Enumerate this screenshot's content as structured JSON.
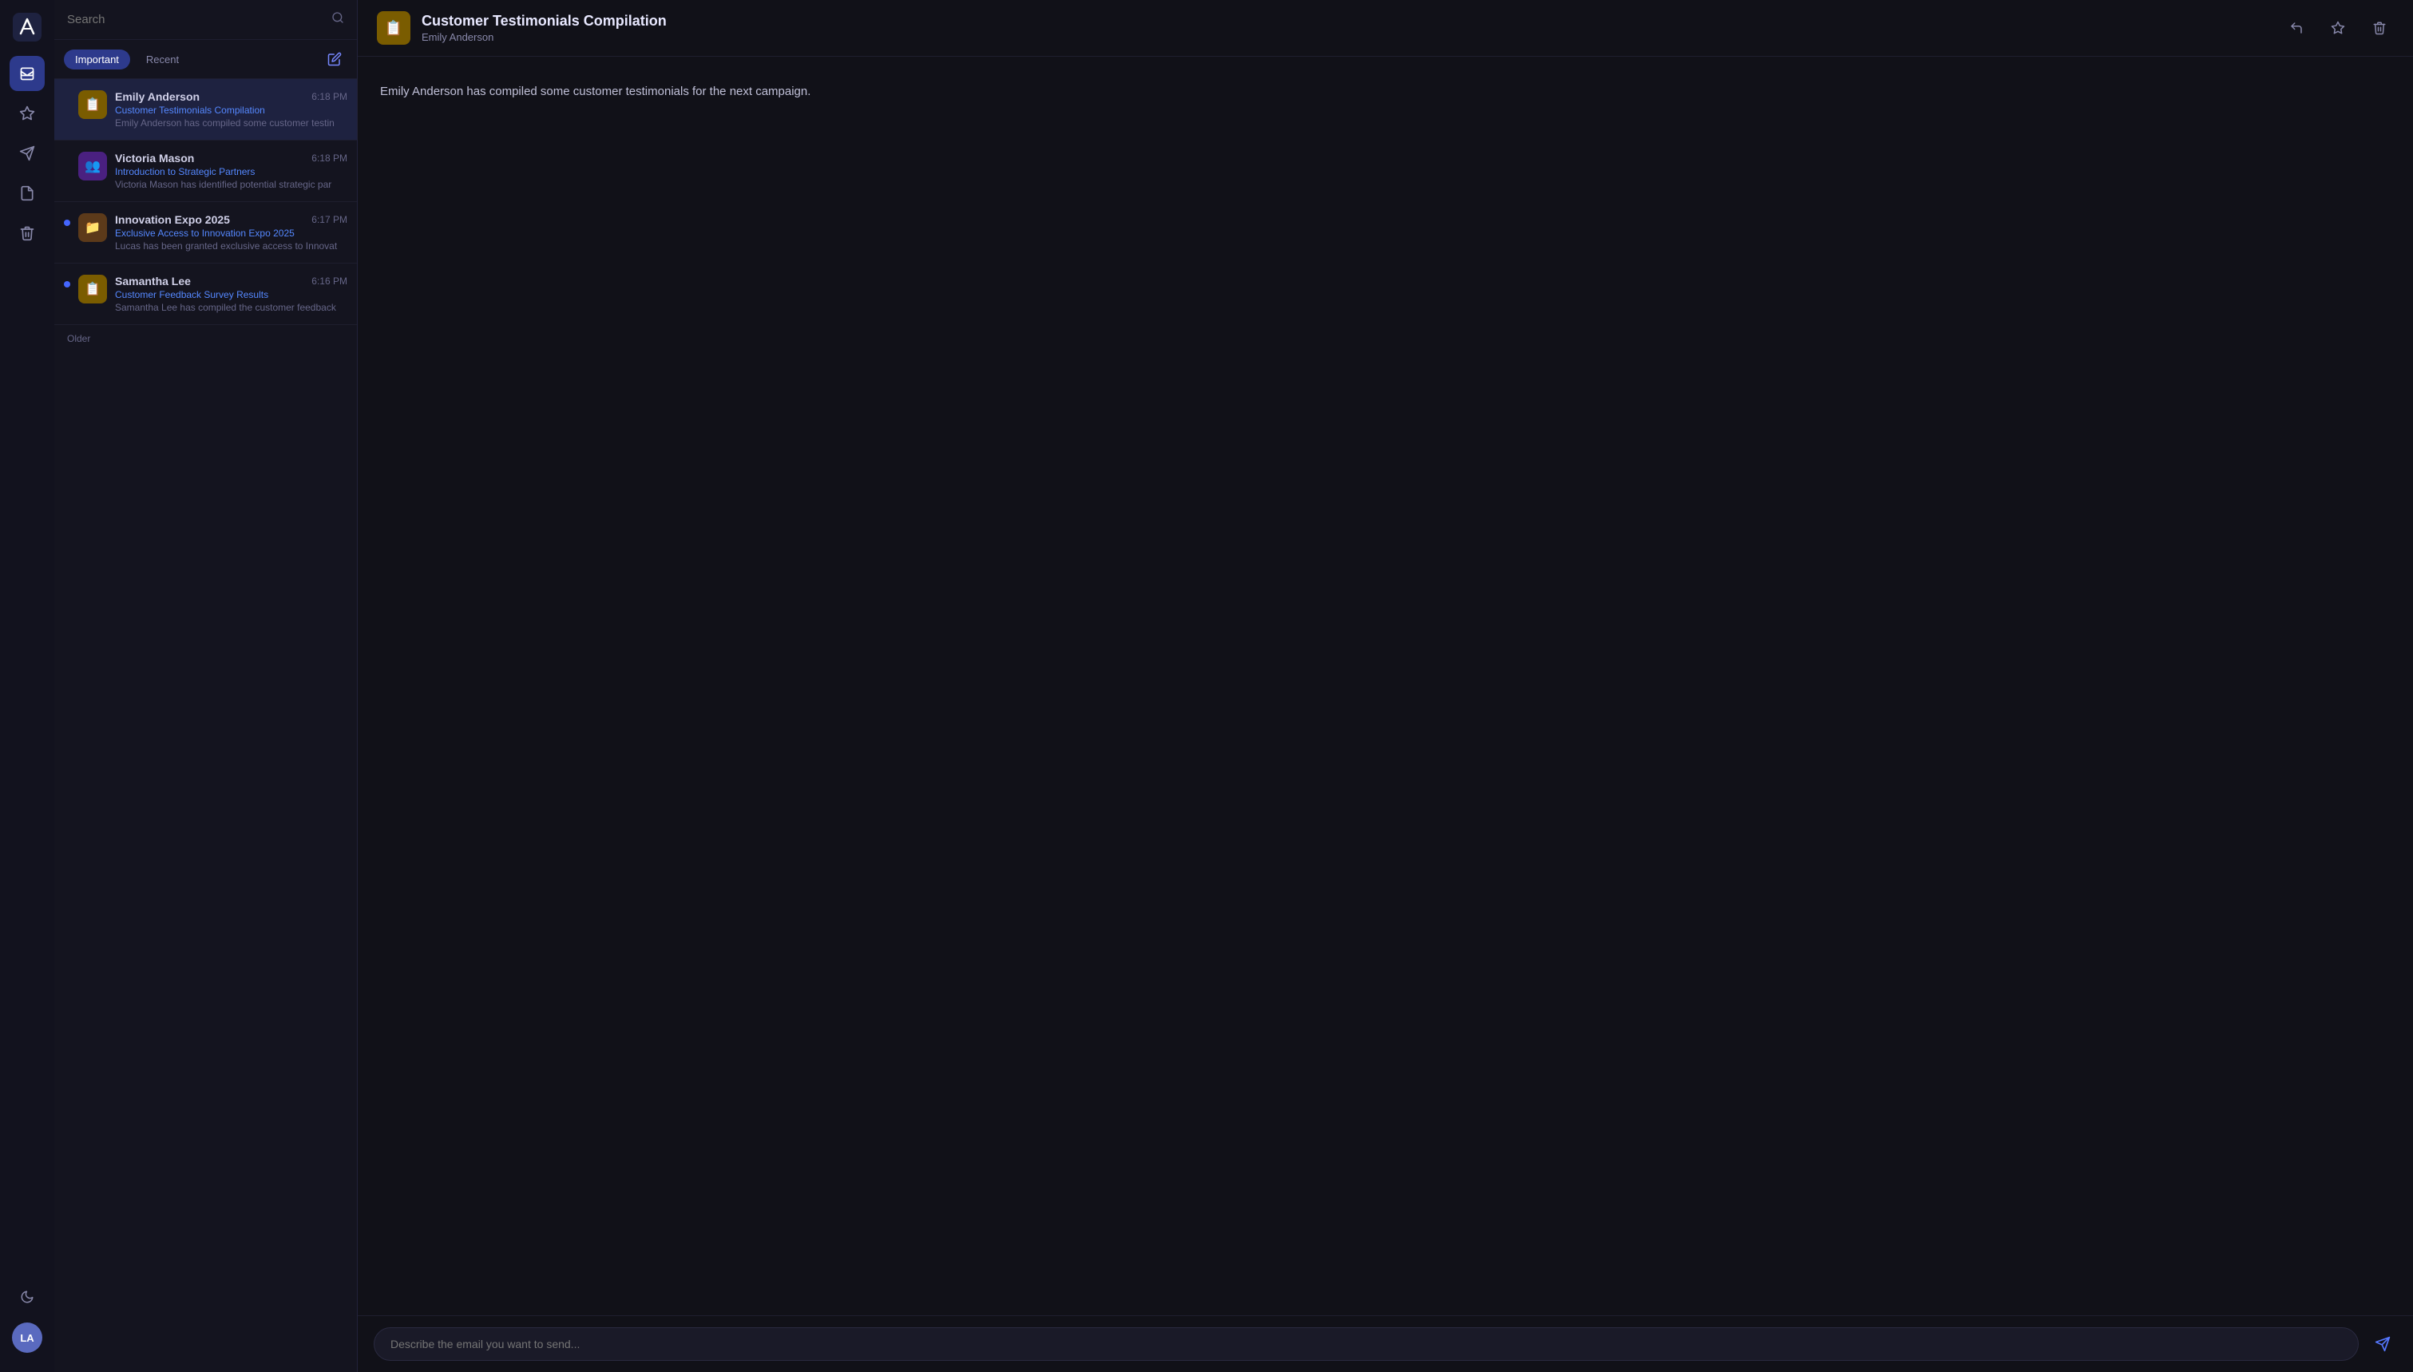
{
  "app": {
    "logo_text": "A",
    "avatar_initials": "LA"
  },
  "sidebar": {
    "icons": [
      {
        "name": "inbox-icon",
        "symbol": "✉",
        "active": true
      },
      {
        "name": "star-icon",
        "symbol": "☆",
        "active": false
      },
      {
        "name": "send-icon",
        "symbol": "➤",
        "active": false
      },
      {
        "name": "draft-icon",
        "symbol": "📄",
        "active": false
      },
      {
        "name": "trash-icon",
        "symbol": "🗑",
        "active": false
      }
    ]
  },
  "search": {
    "placeholder": "Search"
  },
  "tabs": [
    {
      "label": "Important",
      "active": true
    },
    {
      "label": "Recent",
      "active": false
    }
  ],
  "email_list": {
    "items": [
      {
        "id": "email-1",
        "sender": "Emily Anderson",
        "subject": "Customer Testimonials Compilation",
        "preview": "Emily Anderson has compiled some customer testin",
        "time": "6:18 PM",
        "avatar_emoji": "📋",
        "avatar_class": "yellow",
        "unread": false,
        "selected": true
      },
      {
        "id": "email-2",
        "sender": "Victoria Mason",
        "subject": "Introduction to Strategic Partners",
        "preview": "Victoria Mason has identified potential strategic par",
        "time": "6:18 PM",
        "avatar_emoji": "👥",
        "avatar_class": "purple",
        "unread": false,
        "selected": false
      },
      {
        "id": "email-3",
        "sender": "Innovation Expo 2025",
        "subject": "Exclusive Access to Innovation Expo 2025",
        "preview": "Lucas has been granted exclusive access to Innovat",
        "time": "6:17 PM",
        "avatar_emoji": "📁",
        "avatar_class": "brown",
        "unread": true,
        "selected": false
      },
      {
        "id": "email-4",
        "sender": "Samantha Lee",
        "subject": "Customer Feedback Survey Results",
        "preview": "Samantha Lee has compiled the customer feedback",
        "time": "6:16 PM",
        "avatar_emoji": "📋",
        "avatar_class": "yellow",
        "unread": true,
        "selected": false
      }
    ],
    "older_label": "Older"
  },
  "email_detail": {
    "avatar_emoji": "📋",
    "title": "Customer Testimonials Compilation",
    "sender": "Emily Anderson",
    "body": "Emily Anderson has compiled some customer testimonials for the next campaign."
  },
  "compose": {
    "placeholder": "Describe the email you want to send..."
  },
  "actions": {
    "reply_label": "↩",
    "star_label": "☆",
    "delete_label": "🗑"
  }
}
